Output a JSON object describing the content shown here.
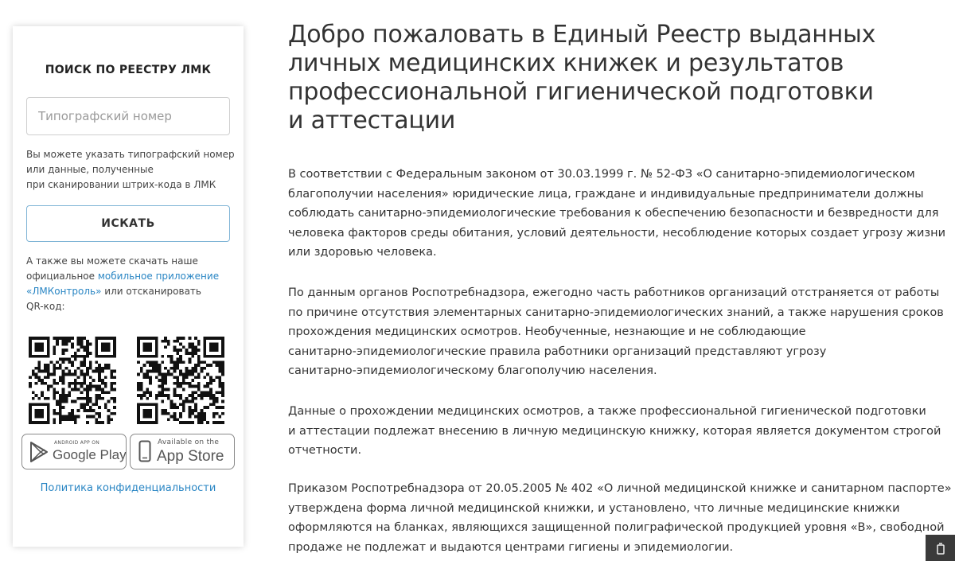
{
  "sidebar": {
    "title": "ПОИСК ПО РЕЕСТРУ ЛМК",
    "search_placeholder": "Типографский номер",
    "search_value": "",
    "hint_lines": [
      "Вы можете указать типографский номер",
      "или данные, полученные",
      "при сканировании штрих-кода в ЛМК"
    ],
    "search_button": "ИСКАТЬ",
    "download": {
      "line1": "А также вы можете скачать наше",
      "line2_prefix": "официальное ",
      "link_part1": "мобильное приложение",
      "link_part2": "«ЛМКонтроль»",
      "after_link": " или отсканировать",
      "line4": "QR-код:"
    },
    "google_badge": {
      "small": "ANDROID APP ON",
      "big": "Google Play",
      "icon": "google-play-icon"
    },
    "apple_badge": {
      "small": "Available on the",
      "big": "App Store",
      "icon": "phone-icon"
    },
    "privacy_link": "Политика конфиденциальности"
  },
  "main": {
    "title_lines": [
      "Добро пожаловать в Единый Реестр выданных",
      "личных медицинских книжек и результатов",
      "профессиональной гигиенической подготовки",
      "и аттестации"
    ],
    "paragraphs": [
      [
        "В соответствии с Федеральным законом от 30.03.1999 г. № 52-ФЗ «О санитарно-эпидемиологическом",
        "благополучии населения» юридические лица, граждане и индивидуальные предприниматели должны",
        "соблюдать санитарно-эпидемиологические требования к обеспечению безопасности и безвредности для",
        "человека факторов среды обитания, условий деятельности, несоблюдение которых создает угрозу жизни",
        "или здоровью человека."
      ],
      [
        "По данным органов Роспотребнадзора, ежегодно часть работников организаций отстраняется от работы",
        "по причине отсутствия элементарных санитарно-эпидемиологических знаний, а также нарушения сроков",
        "прохождения медицинских осмотров. Необученные, незнающие и не соблюдающие",
        "санитарно-эпидемиологические правила работники организаций представляют угрозу",
        "санитарно-эпидемиологическому благополучию населения."
      ],
      [
        "Данные о прохождении медицинских осмотров, а также профессиональной гигиенической подготовки",
        "и аттестации подлежат внесению в личную медицинскую книжку, которая является документом строгой",
        "отчетности."
      ],
      [
        "Приказом Роспотребнадзора от 20.05.2005 № 402 «О личной медицинской книжке и санитарном паспорте»",
        "утверждена форма личной медицинской книжки, и установлено, что личные медицинские книжки",
        "оформляются на бланках, являющихся защищенной полиграфической продукцией уровня «В», свободной",
        "продаже не подлежат и выдаются центрами гигиены и эпидемиологии."
      ]
    ]
  },
  "colors": {
    "link": "#2a86c4",
    "button_border": "#7fb4d6",
    "text": "#333333",
    "scroll_button": "#3a3a3a"
  },
  "icons": {
    "qr_left": "qr-code-icon",
    "qr_right": "qr-code-icon",
    "scroll": "scroll-top-icon"
  }
}
